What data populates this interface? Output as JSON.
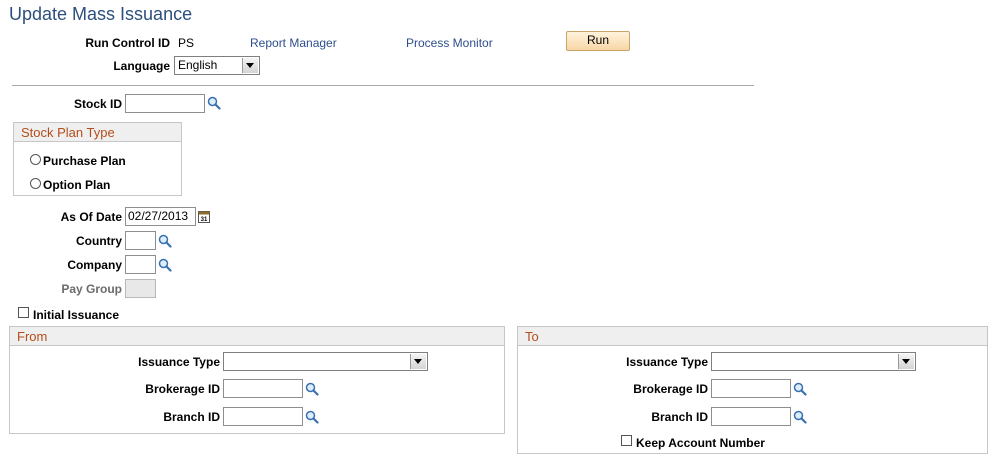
{
  "page": {
    "title": "Update Mass Issuance"
  },
  "run_control": {
    "label": "Run Control ID",
    "value": "PS",
    "report_manager": "Report Manager",
    "process_monitor": "Process Monitor",
    "run_button": "Run",
    "language_label": "Language",
    "language_value": "English"
  },
  "stock": {
    "label": "Stock ID",
    "value": ""
  },
  "stock_plan_type": {
    "title": "Stock Plan Type",
    "options": [
      "Purchase Plan",
      "Option Plan"
    ]
  },
  "as_of_date": {
    "label": "As Of Date",
    "value": "02/27/2013"
  },
  "country": {
    "label": "Country",
    "value": ""
  },
  "company": {
    "label": "Company",
    "value": ""
  },
  "pay_group": {
    "label": "Pay Group",
    "value": ""
  },
  "initial_issuance": {
    "label": "Initial Issuance",
    "checked": false
  },
  "from": {
    "title": "From",
    "issuance_type_label": "Issuance Type",
    "issuance_type_value": "",
    "brokerage_id_label": "Brokerage ID",
    "brokerage_id_value": "",
    "branch_id_label": "Branch ID",
    "branch_id_value": ""
  },
  "to": {
    "title": "To",
    "issuance_type_label": "Issuance Type",
    "issuance_type_value": "",
    "brokerage_id_label": "Brokerage ID",
    "brokerage_id_value": "",
    "branch_id_label": "Branch ID",
    "branch_id_value": "",
    "keep_account_label": "Keep Account Number",
    "keep_account_checked": false
  },
  "icons": {
    "lookup": "magnifier-icon",
    "calendar": "calendar-icon",
    "dropdown": "chevron-down-icon"
  }
}
